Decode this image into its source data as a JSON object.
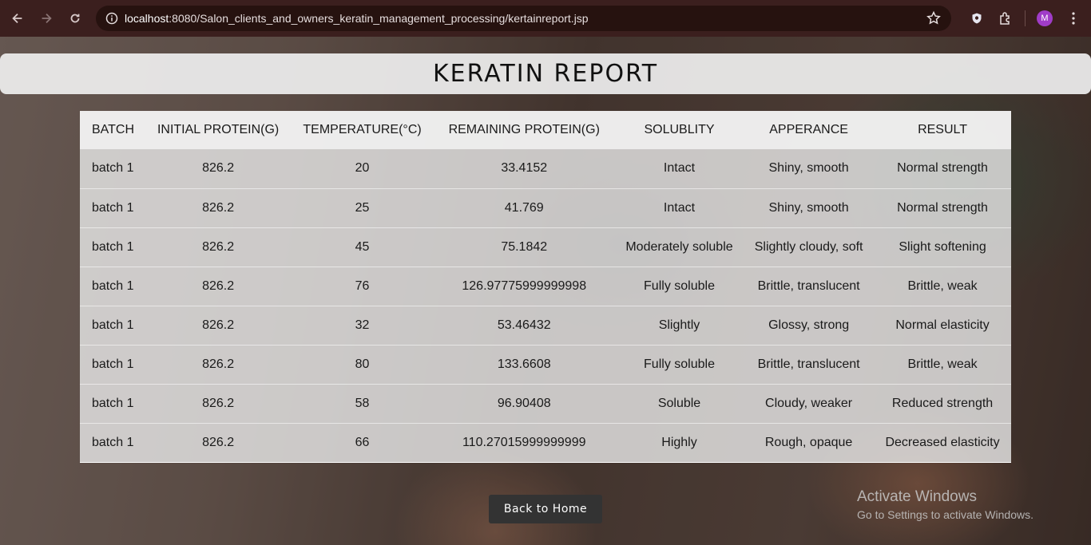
{
  "browser": {
    "url_host": "localhost",
    "url_rest": ":8080/Salon_clients_and_owners_keratin_management_processing/kertainreport.jsp",
    "avatar_initial": "M",
    "accent_color": "#a03cc8"
  },
  "page": {
    "title": "KERATIN REPORT",
    "back_button": "Back to Home"
  },
  "table": {
    "headers": [
      "BATCH",
      "INITIAL PROTEIN(G)",
      "TEMPERATURE(°C)",
      "REMAINING PROTEIN(G)",
      "SOLUBLITY",
      "APPERANCE",
      "RESULT"
    ],
    "rows": [
      [
        "batch 1",
        "826.2",
        "20",
        "33.4152",
        "Intact",
        "Shiny, smooth",
        "Normal strength"
      ],
      [
        "batch 1",
        "826.2",
        "25",
        "41.769",
        "Intact",
        "Shiny, smooth",
        "Normal strength"
      ],
      [
        "batch 1",
        "826.2",
        "45",
        "75.1842",
        "Moderately soluble",
        "Slightly cloudy, soft",
        "Slight softening"
      ],
      [
        "batch 1",
        "826.2",
        "76",
        "126.97775999999998",
        "Fully soluble",
        "Brittle, translucent",
        "Brittle, weak"
      ],
      [
        "batch 1",
        "826.2",
        "32",
        "53.46432",
        "Slightly",
        "Glossy, strong",
        "Normal elasticity"
      ],
      [
        "batch 1",
        "826.2",
        "80",
        "133.6608",
        "Fully soluble",
        "Brittle, translucent",
        "Brittle, weak"
      ],
      [
        "batch 1",
        "826.2",
        "58",
        "96.90408",
        "Soluble",
        "Cloudy, weaker",
        "Reduced strength"
      ],
      [
        "batch 1",
        "826.2",
        "66",
        "110.27015999999999",
        "Highly",
        "Rough, opaque",
        "Decreased elasticity"
      ]
    ]
  },
  "watermark": {
    "line1": "Activate Windows",
    "line2": "Go to Settings to activate Windows."
  }
}
